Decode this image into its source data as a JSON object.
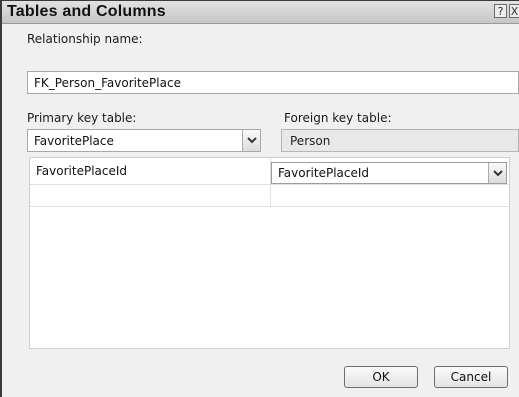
{
  "window": {
    "title": "Tables and Columns",
    "help_button": "?",
    "close_button": "X"
  },
  "relationship": {
    "label": "Relationship name:",
    "value": "FK_Person_FavoritePlace"
  },
  "primary_key": {
    "label": "Primary key table:",
    "value": "FavoritePlace"
  },
  "foreign_key": {
    "label": "Foreign key table:",
    "value": "Person"
  },
  "columns": {
    "rows": [
      {
        "primary": "FavoritePlaceId",
        "foreign": "FavoritePlaceId"
      },
      {
        "primary": "",
        "foreign": ""
      }
    ]
  },
  "buttons": {
    "ok": "OK",
    "cancel": "Cancel"
  }
}
